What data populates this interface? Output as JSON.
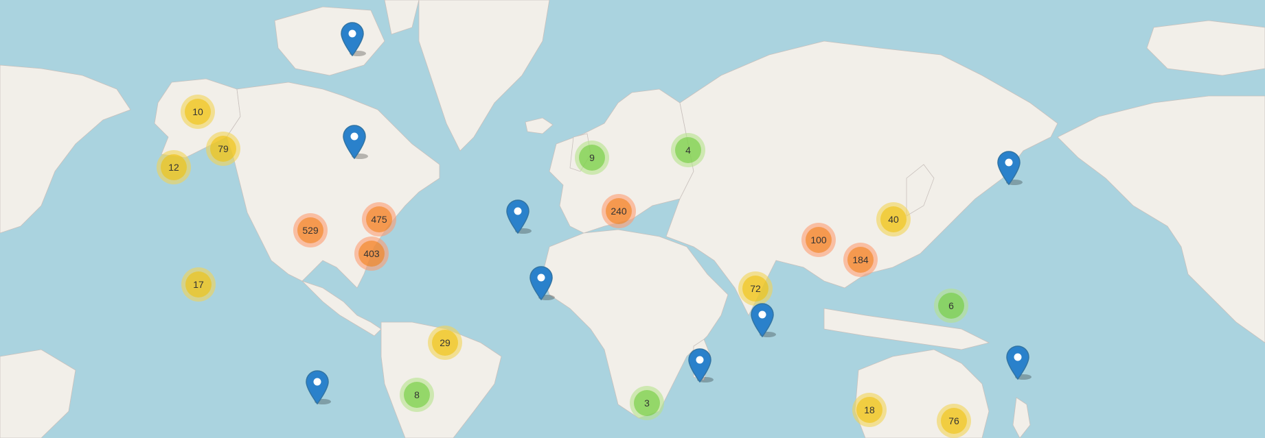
{
  "map": {
    "colors": {
      "ocean": "#aad3df",
      "land": "#f2efe9",
      "borders": "#c5b8c8",
      "marker": "#2a81cb",
      "marker_dark": "#3274a3"
    },
    "clusters": [
      {
        "count": "10",
        "size": "medium"
      },
      {
        "count": "79",
        "size": "medium"
      },
      {
        "count": "12",
        "size": "medium"
      },
      {
        "count": "529",
        "size": "large"
      },
      {
        "count": "475",
        "size": "large"
      },
      {
        "count": "403",
        "size": "large"
      },
      {
        "count": "17",
        "size": "medium"
      },
      {
        "count": "29",
        "size": "medium"
      },
      {
        "count": "8",
        "size": "small"
      },
      {
        "count": "9",
        "size": "small"
      },
      {
        "count": "4",
        "size": "small"
      },
      {
        "count": "240",
        "size": "large"
      },
      {
        "count": "3",
        "size": "small"
      },
      {
        "count": "72",
        "size": "medium"
      },
      {
        "count": "100",
        "size": "large"
      },
      {
        "count": "184",
        "size": "large"
      },
      {
        "count": "40",
        "size": "medium"
      },
      {
        "count": "6",
        "size": "small"
      },
      {
        "count": "18",
        "size": "medium"
      },
      {
        "count": "76",
        "size": "medium"
      }
    ],
    "markers": [
      {
        "icon": "map-pin-icon"
      },
      {
        "icon": "map-pin-icon"
      },
      {
        "icon": "map-pin-icon"
      },
      {
        "icon": "map-pin-icon"
      },
      {
        "icon": "map-pin-icon"
      },
      {
        "icon": "map-pin-icon"
      },
      {
        "icon": "map-pin-icon"
      },
      {
        "icon": "map-pin-icon"
      },
      {
        "icon": "map-pin-icon"
      }
    ]
  }
}
